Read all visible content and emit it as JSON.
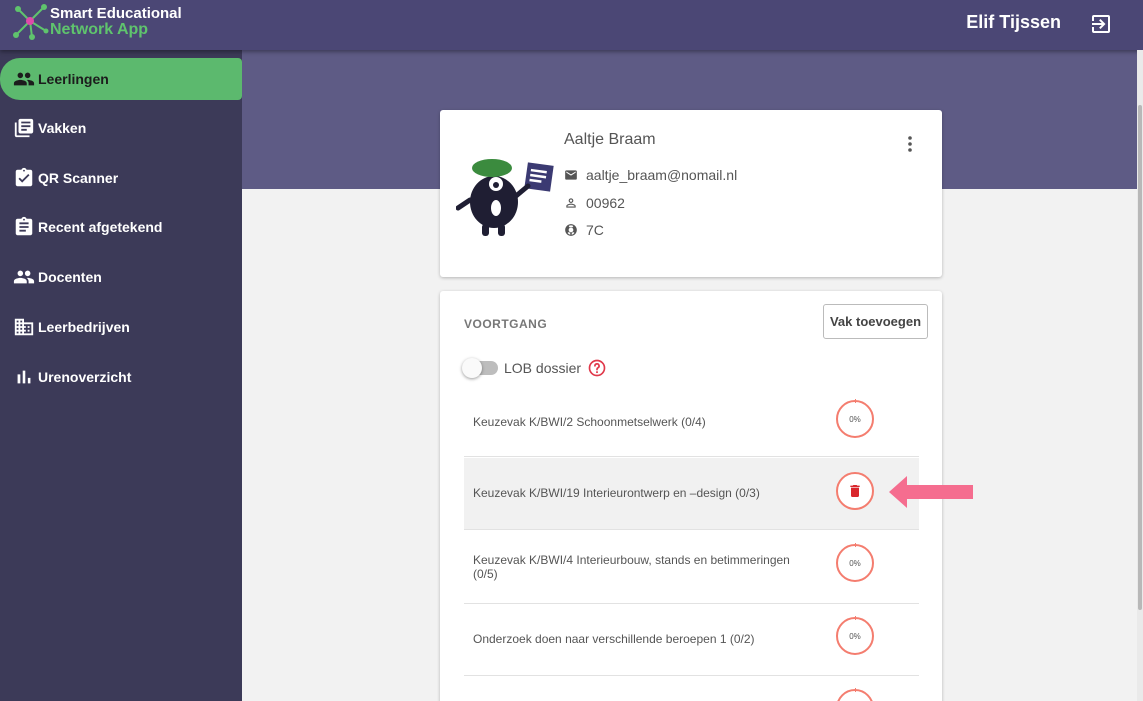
{
  "app": {
    "brand_line1": "Smart Educational",
    "brand_line2": "Network App",
    "user_name": "Elif Tijssen"
  },
  "colors": {
    "topbar": "#4b4775",
    "sidebar": "#3c3a58",
    "active_nav": "#5cb96e",
    "band": "#5e5b85",
    "accent_red": "#f47d6f",
    "arrow_pink": "#f56d8f"
  },
  "sidebar": {
    "items": [
      {
        "label": "Leerlingen",
        "icon": "people-icon",
        "active": true
      },
      {
        "label": "Vakken",
        "icon": "library-icon",
        "active": false
      },
      {
        "label": "QR Scanner",
        "icon": "clipboard-check-icon",
        "active": false
      },
      {
        "label": "Recent afgetekend",
        "icon": "clipboard-list-icon",
        "active": false
      },
      {
        "label": "Docenten",
        "icon": "people-icon",
        "active": false
      },
      {
        "label": "Leerbedrijven",
        "icon": "building-icon",
        "active": false
      },
      {
        "label": "Urenoverzicht",
        "icon": "bar-chart-icon",
        "active": false
      }
    ]
  },
  "profile": {
    "name": "Aaltje Braam",
    "email": "aaltje_braam@nomail.nl",
    "student_number": "00962",
    "class": "7C"
  },
  "progress": {
    "title": "VOORTGANG",
    "add_button": "Vak toevoegen",
    "lob_label": "LOB dossier",
    "lob_enabled": false,
    "subjects": [
      {
        "label": "Keuzevak K/BWI/2 Schoonmetselwerk (0/4)",
        "percent": "0%"
      },
      {
        "label": "Keuzevak K/BWI/19 Interieurontwerp en –design (0/3)",
        "percent": "0%",
        "hovered": true
      },
      {
        "label": "Keuzevak K/BWI/4 Interieurbouw, stands en betimmeringen (0/5)",
        "percent": "0%"
      },
      {
        "label": "Onderzoek doen naar verschillende beroepen 1 (0/2)",
        "percent": "0%"
      }
    ]
  }
}
